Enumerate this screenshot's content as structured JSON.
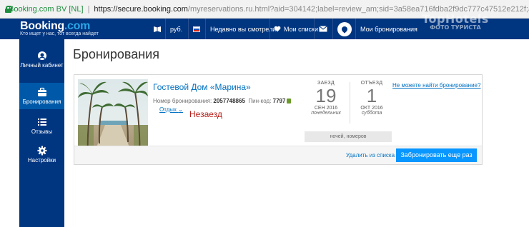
{
  "browser": {
    "site_name": "Booking.com BV [NL]",
    "url_host": "https://secure.booking.com",
    "url_rest": "/myreservations.ru.html?aid=304142;label=review_am;sid=3a58ea716fdba2f9dc777c47512e212f;auth_success=1;lang=ru;selected_curren"
  },
  "header": {
    "logo_main": "Booking",
    "logo_dot": ".com",
    "tagline": "Кто ищет у нас, тот всегда найдет",
    "currency": "руб.",
    "recently_viewed": "Недавно вы смотрели",
    "my_lists": "Мои списки",
    "my_bookings": "Мои бронирования",
    "colors": {
      "brand": "#003580",
      "accent": "#0896ff"
    }
  },
  "sidebar": {
    "items": [
      {
        "label": "Личный кабинет",
        "icon": "profile-icon"
      },
      {
        "label": "Бронирования",
        "icon": "suitcase-icon",
        "active": true
      },
      {
        "label": "Отзывы",
        "icon": "list-icon"
      },
      {
        "label": "Настройки",
        "icon": "gear-icon"
      }
    ]
  },
  "page": {
    "title": "Бронирования"
  },
  "booking": {
    "hotel_name": "Гостевой Дом «Марина»",
    "booking_number_label": "Номер бронирования:",
    "booking_number": "2057748865",
    "pin_label": "Пин-код:",
    "pin": "7797",
    "trip_type": "Отдых",
    "status": "Незаезд",
    "checkin": {
      "label": "ЗАЕЗД",
      "day": "19",
      "month": "СЕН 2016",
      "weekday": "понедельник"
    },
    "checkout": {
      "label": "ОТЪЕЗД",
      "day": "1",
      "month": "ОКТ 2016",
      "weekday": "суббота"
    },
    "nights_rooms": "ночей, номеров",
    "cant_find": "Не можете найти бронирование?",
    "remove_link": "Удалить из списка",
    "rebook_button": "Забронировать еще раз"
  },
  "watermark": {
    "top": "TopHotels",
    "bottom": "ФОТО ТУРИСТА"
  }
}
